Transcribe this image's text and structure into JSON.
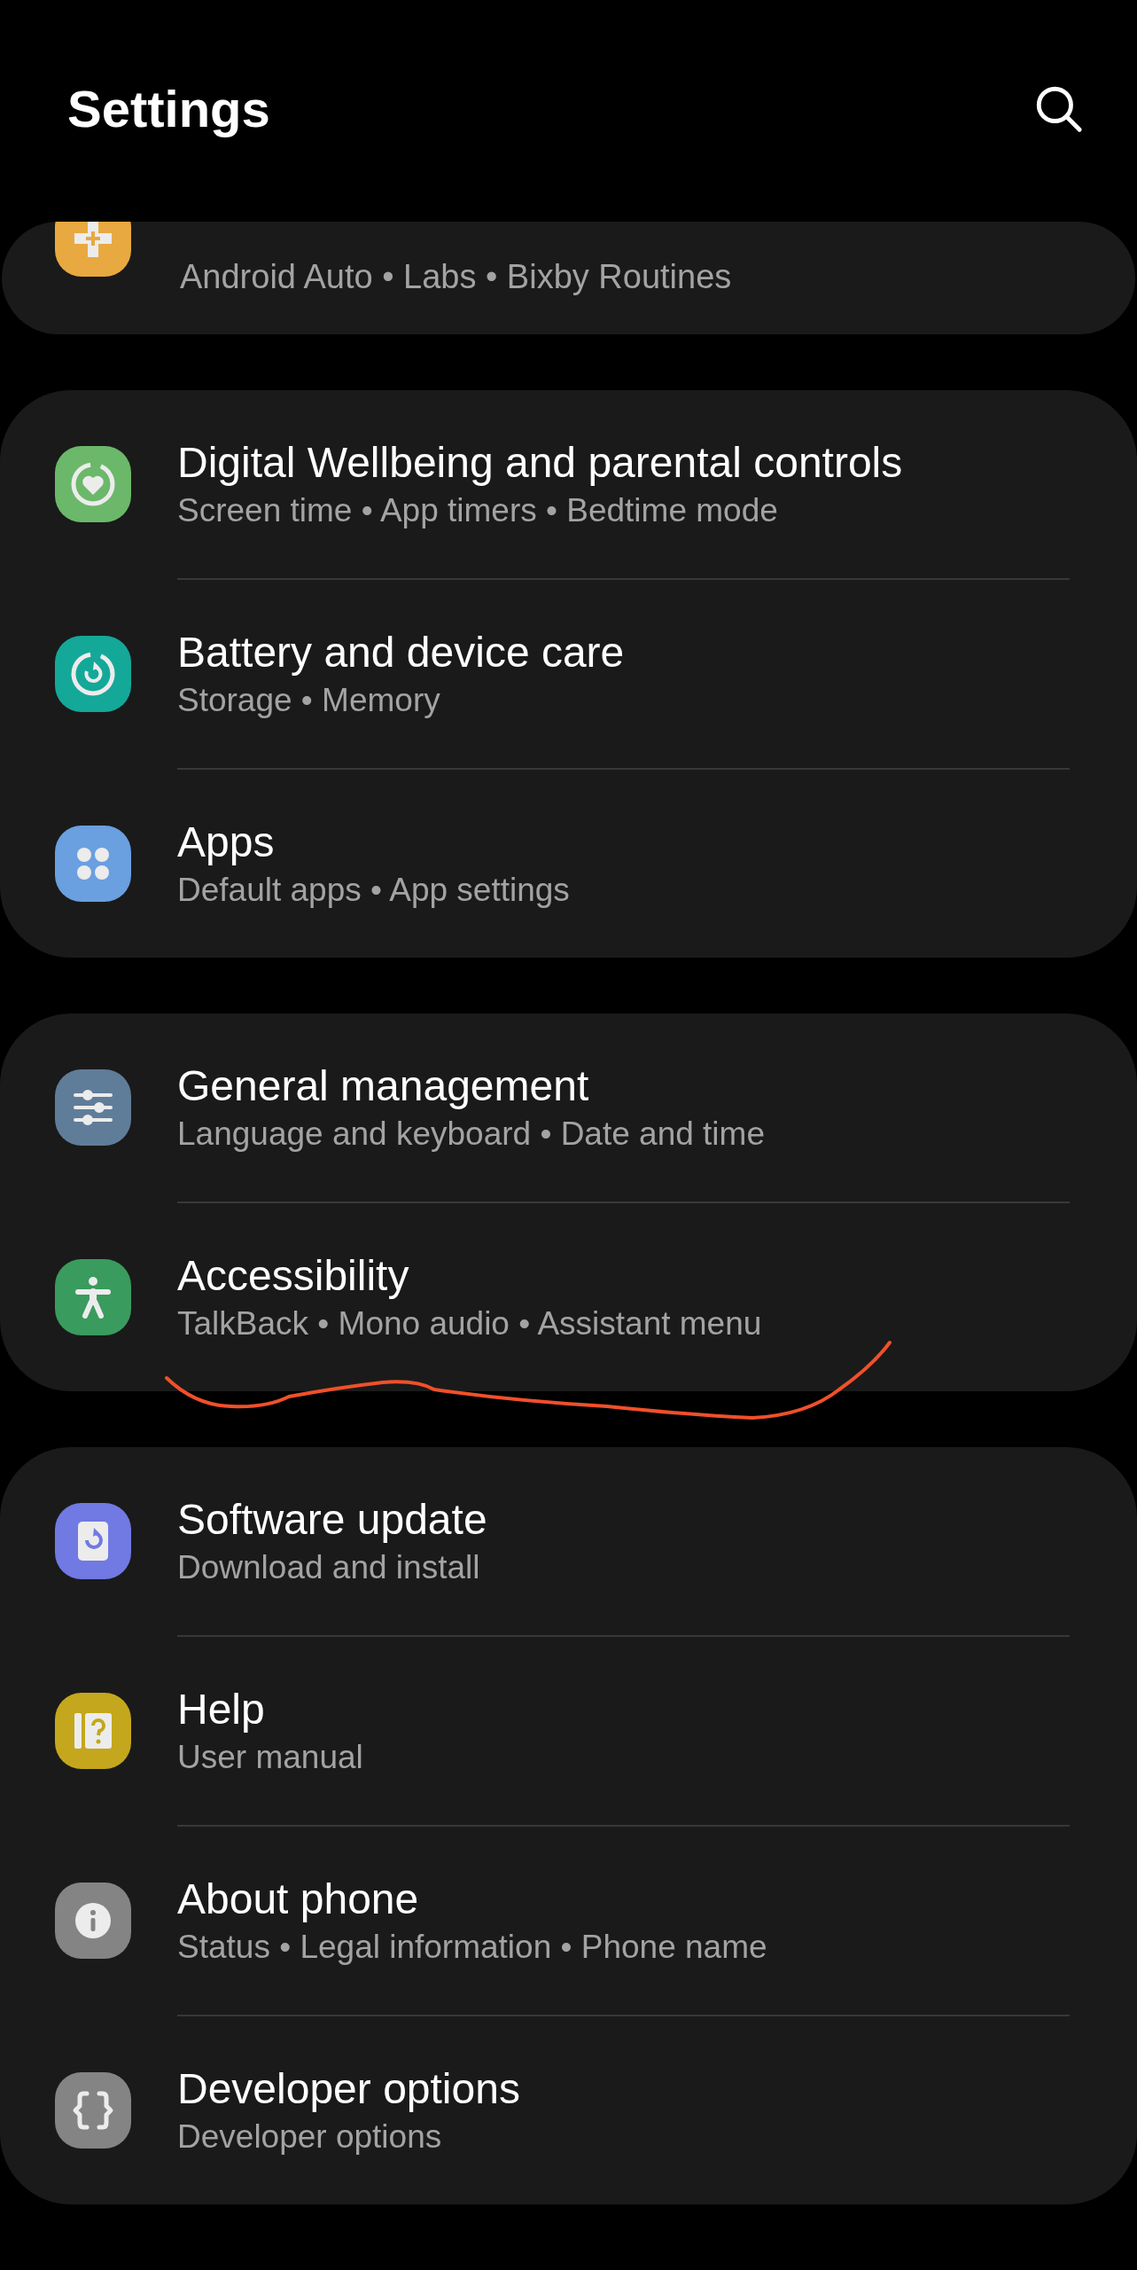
{
  "header": {
    "title": "Settings"
  },
  "partial_group": {
    "subtitle": "Android Auto • Labs • Bixby Routines",
    "color": "#e8a940"
  },
  "groups": [
    {
      "items": [
        {
          "title": "Digital Wellbeing and parental controls",
          "subtitle": "Screen time • App timers • Bedtime mode",
          "color": "#6bb86a"
        },
        {
          "title": "Battery and device care",
          "subtitle": "Storage • Memory",
          "color": "#14a899"
        },
        {
          "title": "Apps",
          "subtitle": "Default apps • App settings",
          "color": "#6a9fe0"
        }
      ]
    },
    {
      "items": [
        {
          "title": "General management",
          "subtitle": "Language and keyboard • Date and time",
          "color": "#5f7d99"
        },
        {
          "title": "Accessibility",
          "subtitle": "TalkBack • Mono audio • Assistant menu",
          "color": "#3a9b5e"
        }
      ]
    },
    {
      "items": [
        {
          "title": "Software update",
          "subtitle": "Download and install",
          "color": "#7179e3"
        },
        {
          "title": "Help",
          "subtitle": "User manual",
          "color": "#c4a71c"
        },
        {
          "title": "About phone",
          "subtitle": "Status • Legal information • Phone name",
          "color": "#848484"
        },
        {
          "title": "Developer options",
          "subtitle": "Developer options",
          "color": "#848484"
        }
      ]
    }
  ]
}
